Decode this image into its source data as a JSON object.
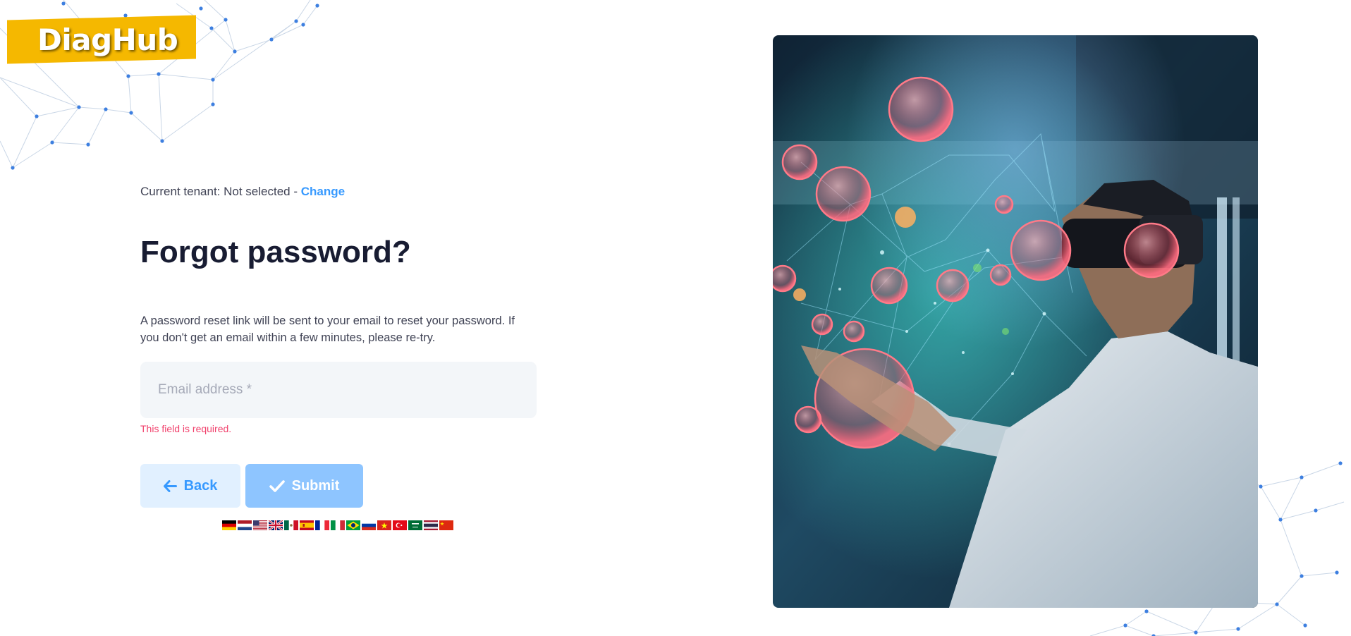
{
  "brand": {
    "logo_text": "DiagHub",
    "logo_color": "#f5b800"
  },
  "tenant": {
    "prefix": "Current tenant: Not selected -",
    "change_label": "Change"
  },
  "form": {
    "title": "Forgot password?",
    "description": "A password reset link will be sent to your email to reset your password. If you don't get an email within a few minutes, please re-try.",
    "email_placeholder": "Email address *",
    "email_value": "",
    "error_text": "This field is required.",
    "back_label": "Back",
    "submit_label": "Submit"
  },
  "languages": [
    {
      "code": "de",
      "name": "German"
    },
    {
      "code": "nl",
      "name": "Dutch"
    },
    {
      "code": "us",
      "name": "English (US)"
    },
    {
      "code": "gb",
      "name": "English (UK)"
    },
    {
      "code": "mx",
      "name": "Spanish (Mexico)"
    },
    {
      "code": "es",
      "name": "Spanish"
    },
    {
      "code": "fr",
      "name": "French"
    },
    {
      "code": "it",
      "name": "Italian"
    },
    {
      "code": "br",
      "name": "Portuguese (Brazil)"
    },
    {
      "code": "ru",
      "name": "Russian"
    },
    {
      "code": "vn",
      "name": "Vietnamese"
    },
    {
      "code": "tr",
      "name": "Turkish"
    },
    {
      "code": "sa",
      "name": "Arabic"
    },
    {
      "code": "th",
      "name": "Thai"
    },
    {
      "code": "cn",
      "name": "Chinese"
    }
  ],
  "colors": {
    "primary": "#3699ff",
    "primary_light": "#e1f0ff",
    "submit_disabled": "#8ec5ff",
    "error": "#f1416c",
    "input_bg": "#f3f6f9",
    "network_node": "#3d7fe0"
  },
  "icons": {
    "back": "arrow-left-icon",
    "submit": "check-icon"
  }
}
